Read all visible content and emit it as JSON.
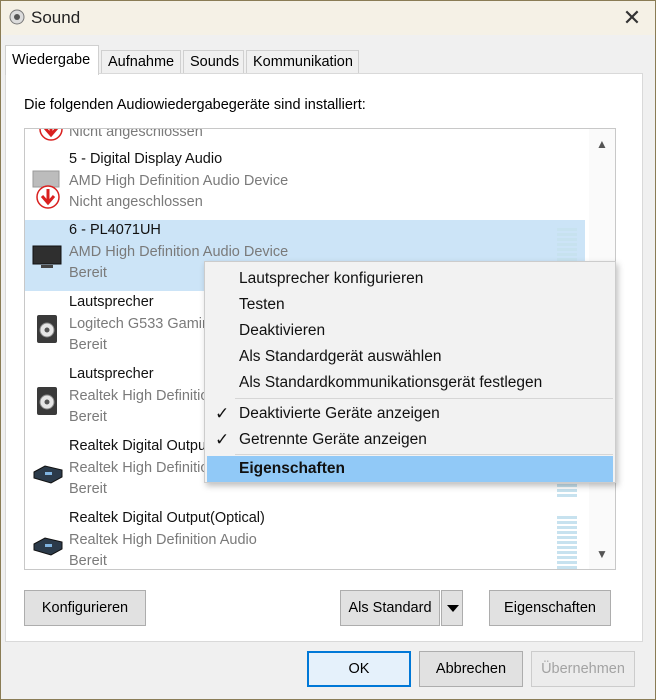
{
  "window": {
    "title": "Sound",
    "close_label": "✕"
  },
  "tabs": [
    {
      "label": "Wiedergabe",
      "active": true
    },
    {
      "label": "Aufnahme",
      "active": false
    },
    {
      "label": "Sounds",
      "active": false
    },
    {
      "label": "Kommunikation",
      "active": false
    }
  ],
  "panel": {
    "heading": "Die folgenden Audiowiedergabegeräte sind installiert:"
  },
  "devices": [
    {
      "name": "",
      "line2": "",
      "line3": "Nicht angeschlossen",
      "icon": "disconnected-arrow-icon"
    },
    {
      "name": "5 - Digital Display Audio",
      "line2": "AMD High Definition Audio Device",
      "line3": "Nicht angeschlossen",
      "icon": "display-disconnected-icon"
    },
    {
      "name": "6 - PL4071UH",
      "line2": "AMD High Definition Audio Device",
      "line3": "Bereit",
      "icon": "monitor-icon",
      "selected": true
    },
    {
      "name": "Lautsprecher",
      "line2": "Logitech G533 Gaming Headset",
      "line3": "Bereit",
      "icon": "speaker-icon"
    },
    {
      "name": "Lautsprecher",
      "line2": "Realtek High Definition Audio",
      "line3": "Bereit",
      "icon": "speaker-icon"
    },
    {
      "name": "Realtek Digital Output",
      "line2": "Realtek High Definition Audio",
      "line3": "Bereit",
      "icon": "digital-output-icon"
    },
    {
      "name": "Realtek Digital Output(Optical)",
      "line2": "Realtek High Definition Audio",
      "line3": "Bereit",
      "icon": "digital-output-icon"
    }
  ],
  "context_menu": {
    "items": [
      {
        "label": "Lautsprecher konfigurieren"
      },
      {
        "label": "Testen"
      },
      {
        "label": "Deaktivieren"
      },
      {
        "label": "Als Standardgerät auswählen"
      },
      {
        "label": "Als Standardkommunikationsgerät festlegen"
      },
      {
        "label": "Deaktivierte Geräte anzeigen",
        "checked": true
      },
      {
        "label": "Getrennte Geräte anzeigen",
        "checked": true
      },
      {
        "label": "Eigenschaften",
        "highlighted": true
      }
    ],
    "check_glyph": "✓"
  },
  "buttons": {
    "configure": "Konfigurieren",
    "set_default": "Als Standard",
    "properties": "Eigenschaften",
    "ok": "OK",
    "cancel": "Abbrechen",
    "apply": "Übernehmen"
  },
  "colors": {
    "selection": "#cce4f7",
    "menu_highlight": "#91c9f7",
    "disconnected_red": "#d9201f"
  }
}
